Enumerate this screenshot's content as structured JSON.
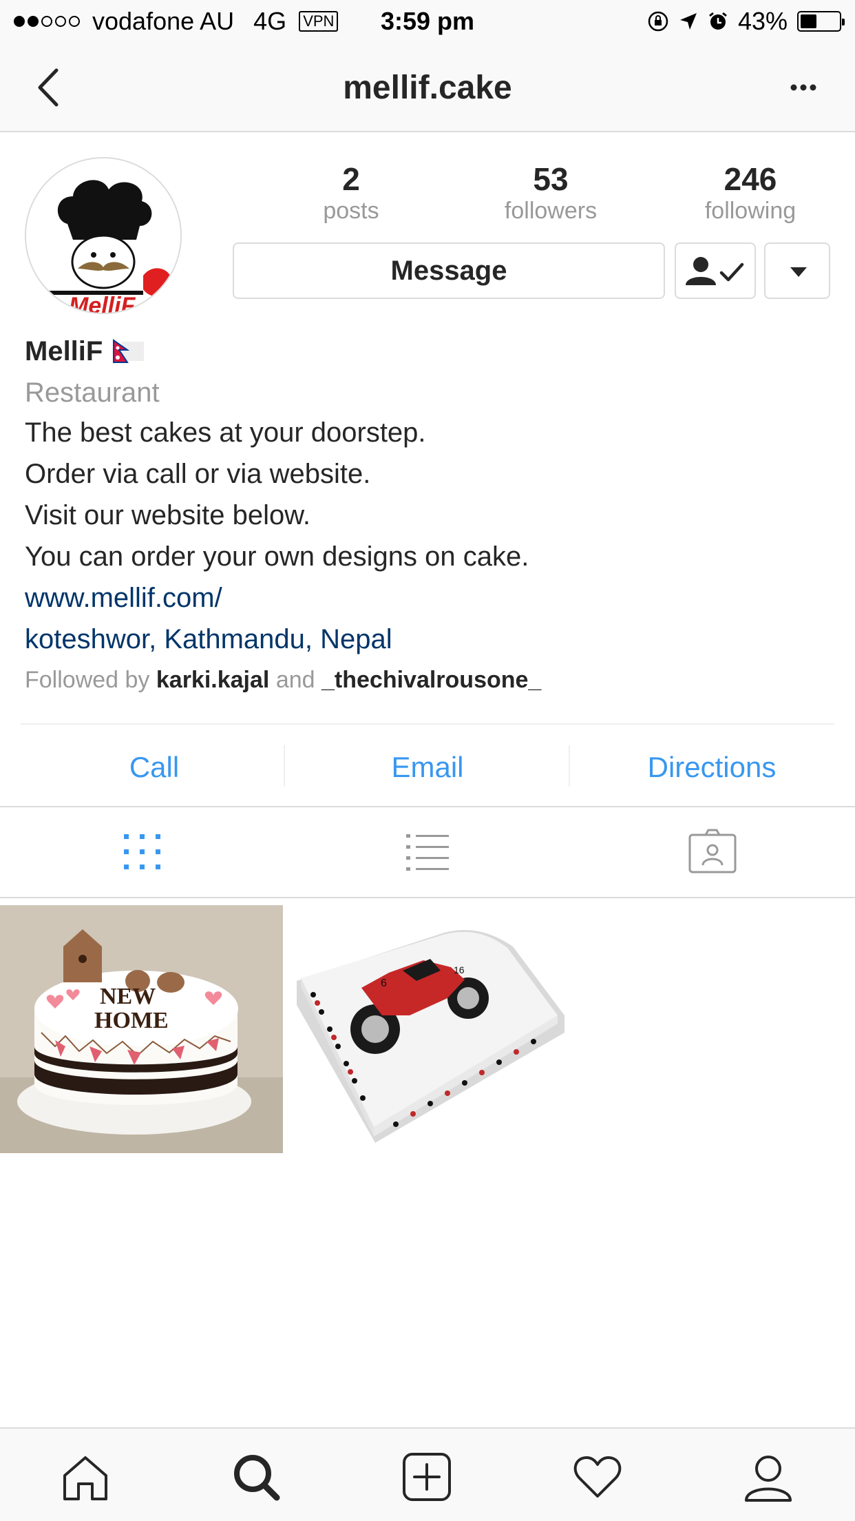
{
  "status_bar": {
    "carrier": "vodafone AU",
    "network": "4G",
    "vpn": "VPN",
    "time": "3:59 pm",
    "battery": "43%",
    "battery_level": 0.43
  },
  "nav": {
    "title": "mellif.cake"
  },
  "profile": {
    "avatar_text": "MelliF",
    "stats": {
      "posts": {
        "value": "2",
        "label": "posts"
      },
      "followers": {
        "value": "53",
        "label": "followers"
      },
      "following": {
        "value": "246",
        "label": "following"
      }
    },
    "message_label": "Message",
    "name": "MelliF",
    "category": "Restaurant",
    "bio_lines": [
      "The best cakes at your doorstep.",
      "Order via call or via website.",
      "Visit our website below.",
      "You can order your own designs on cake."
    ],
    "website": "www.mellif.com/",
    "location": "koteshwor, Kathmandu, Nepal",
    "followed_by_prefix": "Followed by",
    "followed_by_user1": "karki.kajal",
    "followed_by_and": "and",
    "followed_by_user2": "_thechivalrousone_"
  },
  "contact": {
    "call": "Call",
    "email": "Email",
    "directions": "Directions"
  },
  "posts": [
    {
      "text_on_cake_line1": "NEW",
      "text_on_cake_line2": "HOME"
    },
    {
      "bike_number_left": "6",
      "bike_number_right": "16"
    }
  ],
  "colors": {
    "link_blue": "#3897f0",
    "bio_link": "#003569",
    "muted": "#999999",
    "divider": "#dbdbdb"
  }
}
